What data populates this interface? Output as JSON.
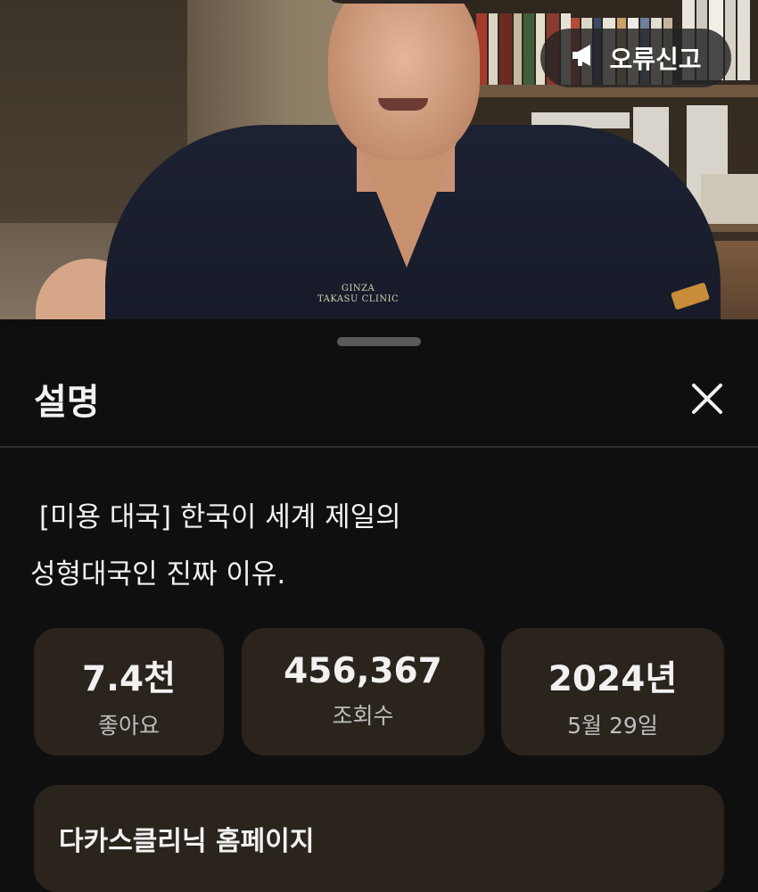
{
  "video": {
    "report_button_label": "오류신고",
    "report_icon": "megaphone-icon",
    "overlay_text": "GINZA\nTAKASU CLINIC"
  },
  "description_sheet": {
    "title": "설명",
    "close_icon": "close-icon",
    "video_title_line1": " [미용 대국] 한국이 세계 제일의",
    "video_title_line2": "성형대국인 진짜 이유.",
    "stats": [
      {
        "value": "7.4천",
        "label": "좋아요"
      },
      {
        "value": "456,367",
        "label": "조회수"
      },
      {
        "value": "2024년",
        "label": "5월 29일"
      }
    ],
    "link_card_title": "다카스클리닉 홈페이지"
  },
  "colors": {
    "sheet_bg": "#0f0f0f",
    "card_bg": "#2a241d",
    "text_primary": "#f1f1f1"
  }
}
